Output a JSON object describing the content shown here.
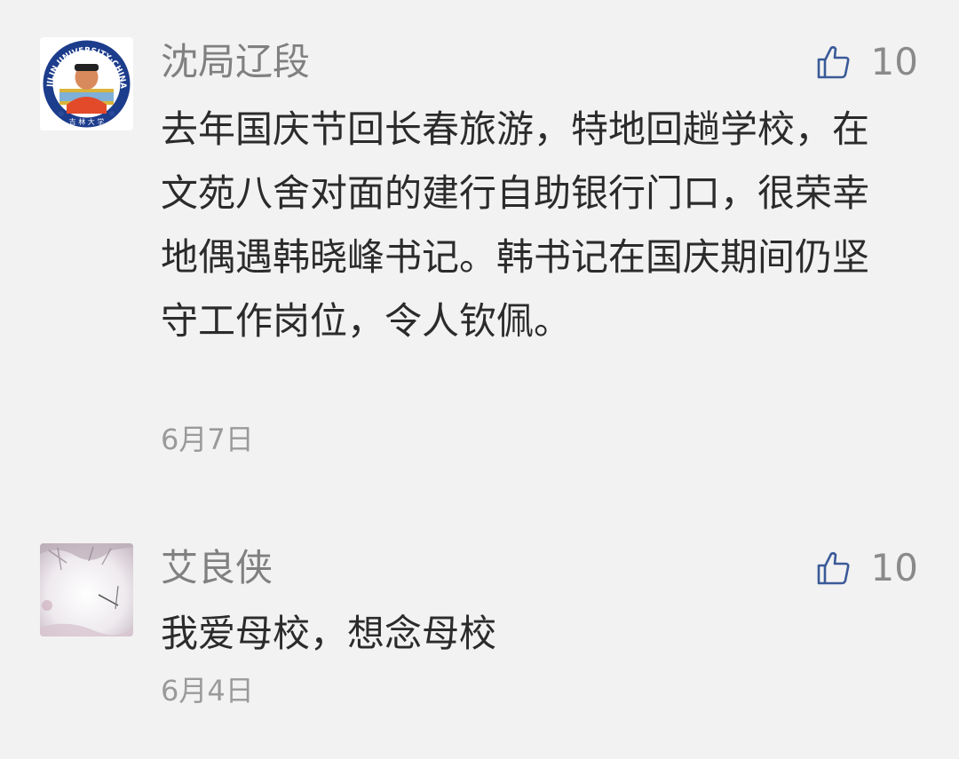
{
  "comments": [
    {
      "author": "沈局辽段",
      "likes": "10",
      "text": "去年国庆节回长春旅游，特地回趟学校，在文苑八舍对面的建行自助银行门口，很荣幸地偶遇韩晓峰书记。韩书记在国庆期间仍坚守工作岗位，令人钦佩。",
      "date": "6月7日",
      "avatar_text": "JILIN UNIVERSITY·CHINA"
    },
    {
      "author": "艾良侠",
      "likes": "10",
      "text": "我爱母校，想念母校",
      "date": "6月4日"
    }
  ],
  "colors": {
    "background": "#f2f2f2",
    "name": "#808080",
    "text": "#2b2b2b",
    "date": "#9a9a9a",
    "like_icon": "#3a5a98"
  },
  "icons": {
    "like": "thumbs-up-icon"
  }
}
